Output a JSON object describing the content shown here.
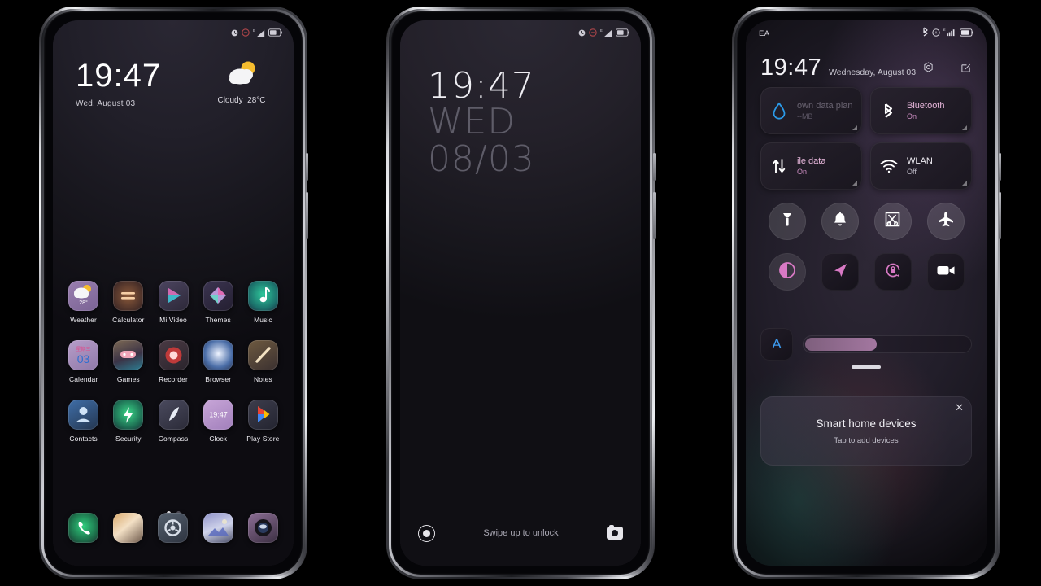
{
  "screenshot": {
    "description": "Three Android (MIUI) phone mockups: home screen, lock screen, control center"
  },
  "phone1": {
    "name": "home-screen",
    "statusbar": {
      "icons": [
        "alarm-icon",
        "dnd-icon",
        "signal-icon",
        "battery-icon"
      ],
      "signal_label": "E"
    },
    "clock": {
      "time": "19:47",
      "date": "Wed, August 03"
    },
    "weather": {
      "icon": "cloudy-sun-icon",
      "condition": "Cloudy",
      "temperature": "28°C"
    },
    "rows": [
      [
        {
          "label": "Weather",
          "icon": "weather-icon",
          "badge": "28°"
        },
        {
          "label": "Calculator",
          "icon": "calculator-icon"
        },
        {
          "label": "Mi Video",
          "icon": "mi-video-icon"
        },
        {
          "label": "Themes",
          "icon": "themes-icon"
        },
        {
          "label": "Music",
          "icon": "music-icon"
        }
      ],
      [
        {
          "label": "Calendar",
          "icon": "calendar-icon",
          "badge": "03",
          "badge_top": "星期三"
        },
        {
          "label": "Games",
          "icon": "games-icon"
        },
        {
          "label": "Recorder",
          "icon": "recorder-icon"
        },
        {
          "label": "Browser",
          "icon": "browser-icon"
        },
        {
          "label": "Notes",
          "icon": "notes-icon"
        }
      ],
      [
        {
          "label": "Contacts",
          "icon": "contacts-icon"
        },
        {
          "label": "Security",
          "icon": "security-icon"
        },
        {
          "label": "Compass",
          "icon": "compass-icon"
        },
        {
          "label": "Clock",
          "icon": "clock-icon",
          "badge": "19:47"
        },
        {
          "label": "Play Store",
          "icon": "play-store-icon"
        }
      ]
    ],
    "page_dots": {
      "count": 2,
      "active": 0
    },
    "dock": [
      {
        "label": "Phone",
        "icon": "phone-icon"
      },
      {
        "label": "Messages",
        "icon": "messages-icon"
      },
      {
        "label": "Settings",
        "icon": "settings-icon"
      },
      {
        "label": "Gallery",
        "icon": "gallery-icon"
      },
      {
        "label": "Camera",
        "icon": "camera-icon"
      }
    ]
  },
  "phone2": {
    "name": "lock-screen",
    "statusbar": {
      "icons": [
        "alarm-icon",
        "dnd-icon",
        "signal-icon",
        "battery-icon"
      ],
      "signal_label": "E"
    },
    "clock": {
      "time": "19:47",
      "weekday": "WED",
      "date": "08/03"
    },
    "footer": {
      "fingerprint_icon": "fingerprint-icon",
      "hint": "Swipe up to unlock",
      "camera_icon": "camera-icon"
    }
  },
  "phone3": {
    "name": "control-center",
    "statusbar": {
      "carrier": "EA",
      "icons": [
        "bluetooth-icon",
        "dnd-icon",
        "signal-icon",
        "battery-icon"
      ],
      "signal_label": "E"
    },
    "header": {
      "time": "19:47",
      "date": "Wednesday, August 03",
      "settings_icon": "gear-hex-icon",
      "edit_icon": "edit-icon"
    },
    "tiles": [
      {
        "name": "data-usage-tile",
        "icon": "data-drop-icon",
        "title": "own data plan",
        "subtitle": "--MB",
        "state": "dim",
        "expandable": true
      },
      {
        "name": "bluetooth-tile",
        "icon": "bluetooth-icon",
        "title": "Bluetooth",
        "subtitle": "On",
        "state": "active",
        "expandable": true
      },
      {
        "name": "mobile-data-tile",
        "icon": "mobile-data-icon",
        "title": "ile data",
        "subtitle": "On",
        "state": "active",
        "expandable": true
      },
      {
        "name": "wlan-tile",
        "icon": "wifi-icon",
        "title": "WLAN",
        "subtitle": "Off",
        "state": "off",
        "expandable": true
      }
    ],
    "toggles": [
      {
        "name": "flashlight-toggle",
        "icon": "flashlight-icon",
        "style": "round"
      },
      {
        "name": "ringtone-toggle",
        "icon": "bell-icon",
        "style": "round"
      },
      {
        "name": "screenshot-toggle",
        "icon": "screenshot-icon",
        "style": "round"
      },
      {
        "name": "airplane-mode-toggle",
        "icon": "airplane-icon",
        "style": "round"
      },
      {
        "name": "dark-mode-toggle",
        "icon": "contrast-icon",
        "style": "round-hl"
      },
      {
        "name": "location-toggle",
        "icon": "location-arrow-icon",
        "style": "square"
      },
      {
        "name": "auto-rotate-toggle",
        "icon": "rotation-lock-icon",
        "style": "square"
      },
      {
        "name": "screen-recorder-toggle",
        "icon": "video-camera-icon",
        "style": "square"
      }
    ],
    "brightness": {
      "auto_label": "A",
      "value_percent": 45
    },
    "smart_home": {
      "title": "Smart home devices",
      "subtitle": "Tap to add devices",
      "close_icon": "close-icon"
    }
  },
  "colors": {
    "accent_pink": "#e9b8dd",
    "accent_blue": "#3d9bf0",
    "bg_dark": "#0b0a0e"
  }
}
